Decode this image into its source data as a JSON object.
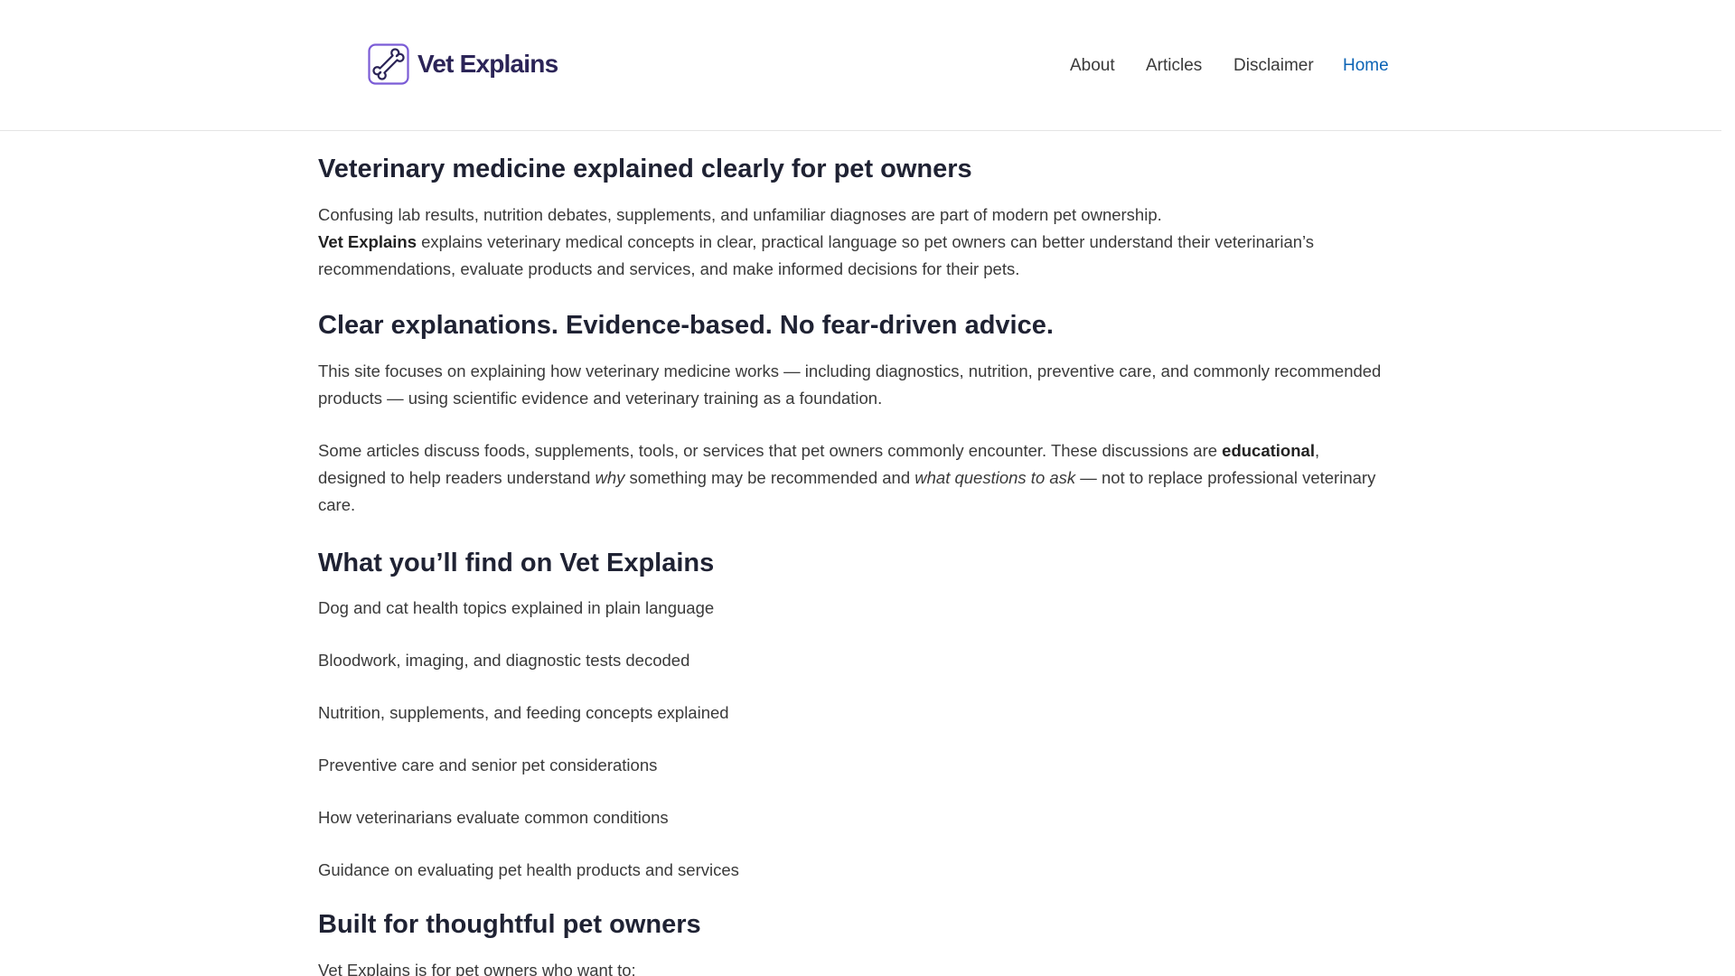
{
  "header": {
    "logo_text": "Vet Explains",
    "logo_icon": "bone-icon",
    "nav": [
      {
        "label": "About"
      },
      {
        "label": "Articles"
      },
      {
        "label": "Disclaimer"
      },
      {
        "label": "Home"
      }
    ]
  },
  "colors": {
    "logo_navy": "#2b2457",
    "logo_purple": "#7b5cd6",
    "active_nav": "#0b63b5",
    "heading": "#1f2233",
    "body_text": "#3a3a3a"
  },
  "content": {
    "title": "Veterinary medicine explained clearly for pet owners",
    "intro": {
      "line1": "Confusing lab results, nutrition debates, supplements, and unfamiliar diagnoses are part of modern pet ownership.",
      "brand": "Vet Explains",
      "line2_rest": " explains veterinary medical concepts in clear, practical language so pet owners can better understand their veterinarian’s recommendations, evaluate products and services, and make informed decisions for their pets."
    },
    "section_clear": {
      "heading": "Clear explanations. Evidence-based. No fear-driven advice.",
      "para1": "This site focuses on explaining how veterinary medicine works — including diagnostics, nutrition, preventive care, and commonly recommended products — using scientific evidence and veterinary training as a foundation.",
      "para2_a": "Some articles discuss foods, supplements, tools, or services that pet owners commonly encounter. These discussions are ",
      "para2_bold": "educational",
      "para2_b": ", designed to help readers understand ",
      "para2_em1": "why",
      "para2_c": " something may be recommended and ",
      "para2_em2": "what questions to ask",
      "para2_d": " — not to replace professional veterinary care."
    },
    "section_find": {
      "heading": "What you’ll find on Vet Explains",
      "items": [
        "Dog and cat health topics explained in plain language",
        "Bloodwork, imaging, and diagnostic tests decoded",
        "Nutrition, supplements, and feeding concepts explained",
        "Preventive care and senior pet considerations",
        "How veterinarians evaluate common conditions",
        "Guidance on evaluating pet health products and services"
      ]
    },
    "section_built": {
      "heading": "Built for thoughtful pet owners",
      "intro": "Vet Explains is for pet owners who want to:"
    }
  }
}
